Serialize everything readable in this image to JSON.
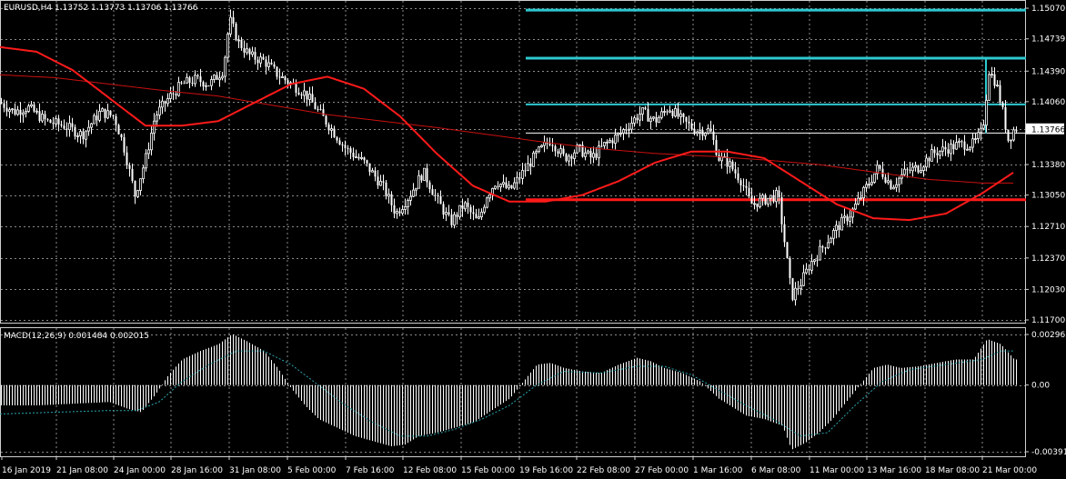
{
  "header": {
    "symbol_info": "EURUSD,H4  1.13752 1.13773 1.13706 1.13766",
    "macd_info": "MACD(12,26,9) 0.001484 0.002015"
  },
  "colors": {
    "background": "#000000",
    "grid": "#8a8a8a",
    "candle": "#ffffff",
    "ma_fast": "#ff1a1a",
    "ma_slow": "#cc1010",
    "levels": "#2ec8d0",
    "support": "#ff1a1a",
    "macd_signal": "#2aa6b0",
    "price_tag_bg": "#ffffff",
    "price_tag_text": "#000000"
  },
  "chart_data": [
    {
      "type": "candlestick",
      "symbol": "EURUSD",
      "timeframe": "H4",
      "ylim": [
        1.117,
        1.151
      ],
      "y_ticks": [
        "1.15070",
        "1.14739",
        "1.14390",
        "1.14060",
        "1.13766",
        "1.13380",
        "1.13050",
        "1.12710",
        "1.12370",
        "1.12030",
        "1.11700"
      ],
      "last_price": "1.13766",
      "x_ticks": [
        "16 Jan 2019",
        "21 Jan 08:00",
        "24 Jan 00:00",
        "28 Jan 16:00",
        "31 Jan 08:00",
        "5 Feb 00:00",
        "7 Feb 16:00",
        "12 Feb 08:00",
        "15 Feb 00:00",
        "19 Feb 16:00",
        "22 Feb 08:00",
        "27 Feb 00:00",
        "1 Mar 16:00",
        "6 Mar 08:00",
        "11 Mar 00:00",
        "13 Mar 16:00",
        "18 Mar 08:00",
        "21 Mar 00:00"
      ],
      "close_path": [
        [
          0,
          1.1405
        ],
        [
          15,
          1.1395
        ],
        [
          30,
          1.14
        ],
        [
          50,
          1.1385
        ],
        [
          70,
          1.138
        ],
        [
          90,
          1.137
        ],
        [
          110,
          1.1395
        ],
        [
          125,
          1.139
        ],
        [
          135,
          1.136
        ],
        [
          148,
          1.1305
        ],
        [
          160,
          1.1345
        ],
        [
          170,
          1.139
        ],
        [
          185,
          1.141
        ],
        [
          200,
          1.1425
        ],
        [
          215,
          1.143
        ],
        [
          230,
          1.1425
        ],
        [
          245,
          1.144
        ],
        [
          252,
          1.1495
        ],
        [
          262,
          1.147
        ],
        [
          275,
          1.1455
        ],
        [
          290,
          1.145
        ],
        [
          305,
          1.1435
        ],
        [
          320,
          1.1425
        ],
        [
          335,
          1.1415
        ],
        [
          350,
          1.1395
        ],
        [
          365,
          1.1375
        ],
        [
          380,
          1.1355
        ],
        [
          400,
          1.134
        ],
        [
          420,
          1.1315
        ],
        [
          435,
          1.1285
        ],
        [
          450,
          1.1305
        ],
        [
          465,
          1.133
        ],
        [
          480,
          1.13
        ],
        [
          495,
          1.1275
        ],
        [
          510,
          1.1295
        ],
        [
          525,
          1.1275
        ],
        [
          535,
          1.1305
        ],
        [
          545,
          1.132
        ],
        [
          560,
          1.131
        ],
        [
          575,
          1.133
        ],
        [
          590,
          1.135
        ],
        [
          605,
          1.1365
        ],
        [
          620,
          1.1345
        ],
        [
          635,
          1.1355
        ],
        [
          650,
          1.1345
        ],
        [
          665,
          1.136
        ],
        [
          680,
          1.137
        ],
        [
          695,
          1.1385
        ],
        [
          705,
          1.1395
        ],
        [
          720,
          1.1385
        ],
        [
          735,
          1.14
        ],
        [
          750,
          1.1385
        ],
        [
          765,
          1.1375
        ],
        [
          780,
          1.1375
        ],
        [
          790,
          1.1345
        ],
        [
          800,
          1.134
        ],
        [
          815,
          1.132
        ],
        [
          825,
          1.1295
        ],
        [
          840,
          1.13
        ],
        [
          855,
          1.1305
        ],
        [
          862,
          1.1255
        ],
        [
          870,
          1.1195
        ],
        [
          880,
          1.121
        ],
        [
          890,
          1.123
        ],
        [
          905,
          1.125
        ],
        [
          920,
          1.127
        ],
        [
          935,
          1.1285
        ],
        [
          950,
          1.131
        ],
        [
          965,
          1.1335
        ],
        [
          980,
          1.1315
        ],
        [
          995,
          1.133
        ],
        [
          1010,
          1.1335
        ],
        [
          1025,
          1.135
        ],
        [
          1040,
          1.1355
        ],
        [
          1055,
          1.136
        ],
        [
          1070,
          1.136
        ],
        [
          1080,
          1.1375
        ],
        [
          1087,
          1.144
        ],
        [
          1095,
          1.1425
        ],
        [
          1102,
          1.1395
        ],
        [
          1108,
          1.1365
        ],
        [
          1115,
          1.1377
        ]
      ],
      "ma_fast": [
        [
          0,
          1.1465
        ],
        [
          40,
          1.146
        ],
        [
          80,
          1.144
        ],
        [
          120,
          1.141
        ],
        [
          160,
          1.138
        ],
        [
          200,
          1.138
        ],
        [
          240,
          1.1385
        ],
        [
          280,
          1.1405
        ],
        [
          320,
          1.1425
        ],
        [
          360,
          1.1433
        ],
        [
          400,
          1.142
        ],
        [
          440,
          1.139
        ],
        [
          480,
          1.135
        ],
        [
          520,
          1.1315
        ],
        [
          560,
          1.1298
        ],
        [
          600,
          1.1298
        ],
        [
          640,
          1.1305
        ],
        [
          680,
          1.132
        ],
        [
          720,
          1.134
        ],
        [
          760,
          1.1352
        ],
        [
          800,
          1.1352
        ],
        [
          840,
          1.1345
        ],
        [
          880,
          1.132
        ],
        [
          920,
          1.1295
        ],
        [
          960,
          1.128
        ],
        [
          1000,
          1.1278
        ],
        [
          1040,
          1.1285
        ],
        [
          1080,
          1.1307
        ],
        [
          1115,
          1.133
        ]
      ],
      "ma_slow": [
        [
          0,
          1.1435
        ],
        [
          60,
          1.1432
        ],
        [
          120,
          1.1425
        ],
        [
          180,
          1.1418
        ],
        [
          240,
          1.1412
        ],
        [
          300,
          1.1402
        ],
        [
          360,
          1.1392
        ],
        [
          420,
          1.1385
        ],
        [
          480,
          1.1378
        ],
        [
          540,
          1.137
        ],
        [
          600,
          1.1362
        ],
        [
          660,
          1.1355
        ],
        [
          720,
          1.135
        ],
        [
          780,
          1.1347
        ],
        [
          840,
          1.1343
        ],
        [
          900,
          1.1338
        ],
        [
          960,
          1.133
        ],
        [
          1020,
          1.1322
        ],
        [
          1080,
          1.1318
        ],
        [
          1115,
          1.1318
        ]
      ],
      "levels": [
        {
          "price": 1.1505,
          "color": "cyan",
          "from": 578,
          "to": 1128,
          "width": 3
        },
        {
          "price": 1.1453,
          "color": "cyan",
          "from": 578,
          "to": 1128,
          "width": 3
        },
        {
          "price": 1.1403,
          "color": "cyan",
          "from": 578,
          "to": 1128,
          "width": 2
        },
        {
          "price": 1.1372,
          "color": "white",
          "from": 578,
          "to": 1128,
          "width": 1
        },
        {
          "price": 1.13,
          "color": "red",
          "from": 578,
          "to": 1128,
          "width": 3
        }
      ]
    },
    {
      "type": "bar",
      "indicator": "MACD(12,26,9)",
      "main": 0.001484,
      "signal": 0.002015,
      "ylim": [
        -0.003918,
        0.002965
      ],
      "y_ticks": [
        "0.002965",
        "0.00",
        "-0.003918"
      ],
      "histogram": [
        [
          0,
          -0.0012
        ],
        [
          40,
          -0.0012
        ],
        [
          80,
          -0.0011
        ],
        [
          120,
          -0.001
        ],
        [
          140,
          -0.0014
        ],
        [
          155,
          -0.0016
        ],
        [
          170,
          -0.0006
        ],
        [
          185,
          0.0006
        ],
        [
          200,
          0.0015
        ],
        [
          220,
          0.002
        ],
        [
          240,
          0.0024
        ],
        [
          255,
          0.003
        ],
        [
          270,
          0.0026
        ],
        [
          290,
          0.002
        ],
        [
          305,
          0.001
        ],
        [
          320,
          -0.0002
        ],
        [
          335,
          -0.0012
        ],
        [
          350,
          -0.002
        ],
        [
          370,
          -0.0025
        ],
        [
          390,
          -0.003
        ],
        [
          410,
          -0.0033
        ],
        [
          430,
          -0.0036
        ],
        [
          445,
          -0.0035
        ],
        [
          460,
          -0.003
        ],
        [
          480,
          -0.0028
        ],
        [
          500,
          -0.0025
        ],
        [
          520,
          -0.0022
        ],
        [
          540,
          -0.0015
        ],
        [
          560,
          -0.0008
        ],
        [
          575,
          0.0002
        ],
        [
          590,
          0.0012
        ],
        [
          605,
          0.0013
        ],
        [
          620,
          0.001
        ],
        [
          640,
          0.0008
        ],
        [
          660,
          0.0007
        ],
        [
          680,
          0.0012
        ],
        [
          700,
          0.0016
        ],
        [
          715,
          0.0014
        ],
        [
          730,
          0.001
        ],
        [
          750,
          0.0007
        ],
        [
          770,
          0.0002
        ],
        [
          790,
          -0.0008
        ],
        [
          805,
          -0.0013
        ],
        [
          820,
          -0.0018
        ],
        [
          840,
          -0.002
        ],
        [
          860,
          -0.0024
        ],
        [
          870,
          -0.0038
        ],
        [
          885,
          -0.0034
        ],
        [
          900,
          -0.0028
        ],
        [
          915,
          -0.002
        ],
        [
          930,
          -0.001
        ],
        [
          945,
          0.0
        ],
        [
          960,
          0.001
        ],
        [
          975,
          0.0012
        ],
        [
          990,
          0.001
        ],
        [
          1010,
          0.0011
        ],
        [
          1030,
          0.0013
        ],
        [
          1050,
          0.0015
        ],
        [
          1070,
          0.0015
        ],
        [
          1085,
          0.0027
        ],
        [
          1100,
          0.0024
        ],
        [
          1115,
          0.0015
        ]
      ],
      "signal_path": [
        [
          0,
          -0.0017
        ],
        [
          60,
          -0.0016
        ],
        [
          120,
          -0.0015
        ],
        [
          150,
          -0.0015
        ],
        [
          175,
          -0.001
        ],
        [
          200,
          0.0002
        ],
        [
          230,
          0.0012
        ],
        [
          260,
          0.002
        ],
        [
          290,
          0.002
        ],
        [
          320,
          0.0012
        ],
        [
          350,
          0.0
        ],
        [
          380,
          -0.0012
        ],
        [
          410,
          -0.0022
        ],
        [
          440,
          -0.003
        ],
        [
          470,
          -0.003
        ],
        [
          500,
          -0.0026
        ],
        [
          530,
          -0.002
        ],
        [
          560,
          -0.0012
        ],
        [
          590,
          0.0
        ],
        [
          620,
          0.0008
        ],
        [
          660,
          0.0007
        ],
        [
          700,
          0.0011
        ],
        [
          730,
          0.0011
        ],
        [
          760,
          0.0006
        ],
        [
          790,
          -0.0003
        ],
        [
          820,
          -0.0012
        ],
        [
          850,
          -0.002
        ],
        [
          880,
          -0.003
        ],
        [
          910,
          -0.0028
        ],
        [
          940,
          -0.0012
        ],
        [
          970,
          0.0002
        ],
        [
          1000,
          0.0009
        ],
        [
          1040,
          0.0012
        ],
        [
          1080,
          0.0015
        ],
        [
          1100,
          0.002
        ],
        [
          1115,
          0.002
        ]
      ]
    }
  ]
}
